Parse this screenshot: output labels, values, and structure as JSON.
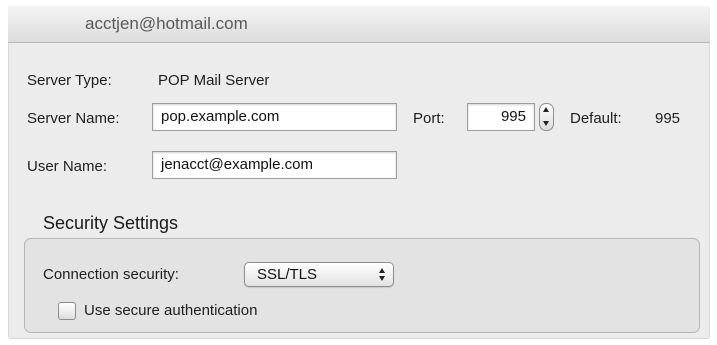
{
  "header": {
    "account": "acctjen@hotmail.com"
  },
  "server_type": {
    "label": "Server Type:",
    "value": "POP Mail Server"
  },
  "server_name": {
    "label": "Server Name:",
    "value": "pop.example.com"
  },
  "port": {
    "label": "Port:",
    "value": "995",
    "default_label": "Default:",
    "default_value": "995"
  },
  "user_name": {
    "label": "User Name:",
    "value": "jenacct@example.com"
  },
  "security": {
    "title": "Security Settings",
    "connection_label": "Connection security:",
    "connection_value": "SSL/TLS",
    "secure_auth_label": "Use secure authentication",
    "secure_auth_checked": false
  },
  "icons": {
    "port_stepper": "stepper-arrows-icon",
    "popup_arrows": "popup-arrows-icon"
  }
}
